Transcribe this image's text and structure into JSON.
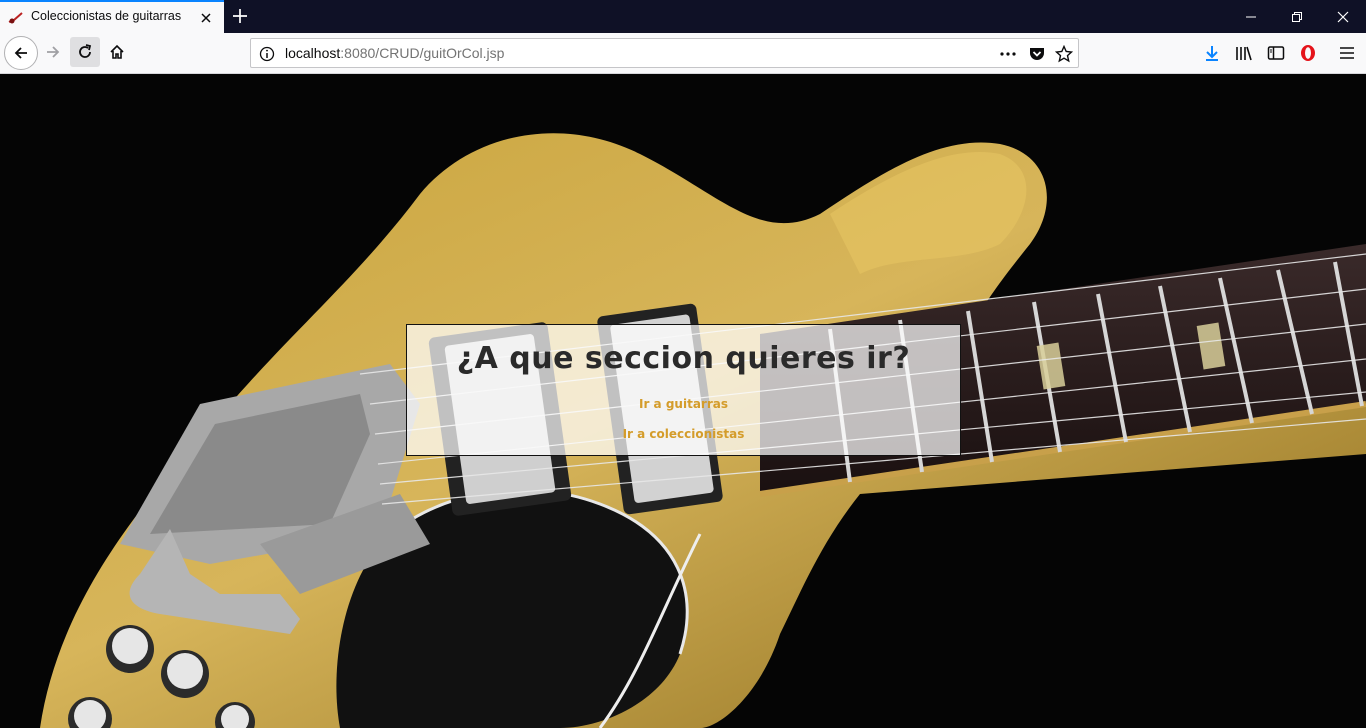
{
  "browser": {
    "tab_title": "Coleccionistas de guitarras",
    "url_host": "localhost",
    "url_path": ":8080/CRUD/guitOrCol.jsp",
    "icons": [
      "back-icon",
      "forward-icon",
      "reload-icon",
      "home-icon",
      "info-icon",
      "more-icon",
      "pocket-icon",
      "star-icon",
      "download-icon",
      "library-icon",
      "sidebar-icon",
      "opera-icon",
      "menu-icon",
      "minimize-icon",
      "restore-icon",
      "close-icon",
      "new-tab-icon"
    ],
    "accent": "#0a84ff"
  },
  "page": {
    "heading": "¿A que seccion quieres ir?",
    "link_guitarras": "Ir a guitarras",
    "link_coleccionistas": "Ir a coleccionistas",
    "link_color": "#d49c2a",
    "background_image": "yellow electric guitar on black background"
  }
}
